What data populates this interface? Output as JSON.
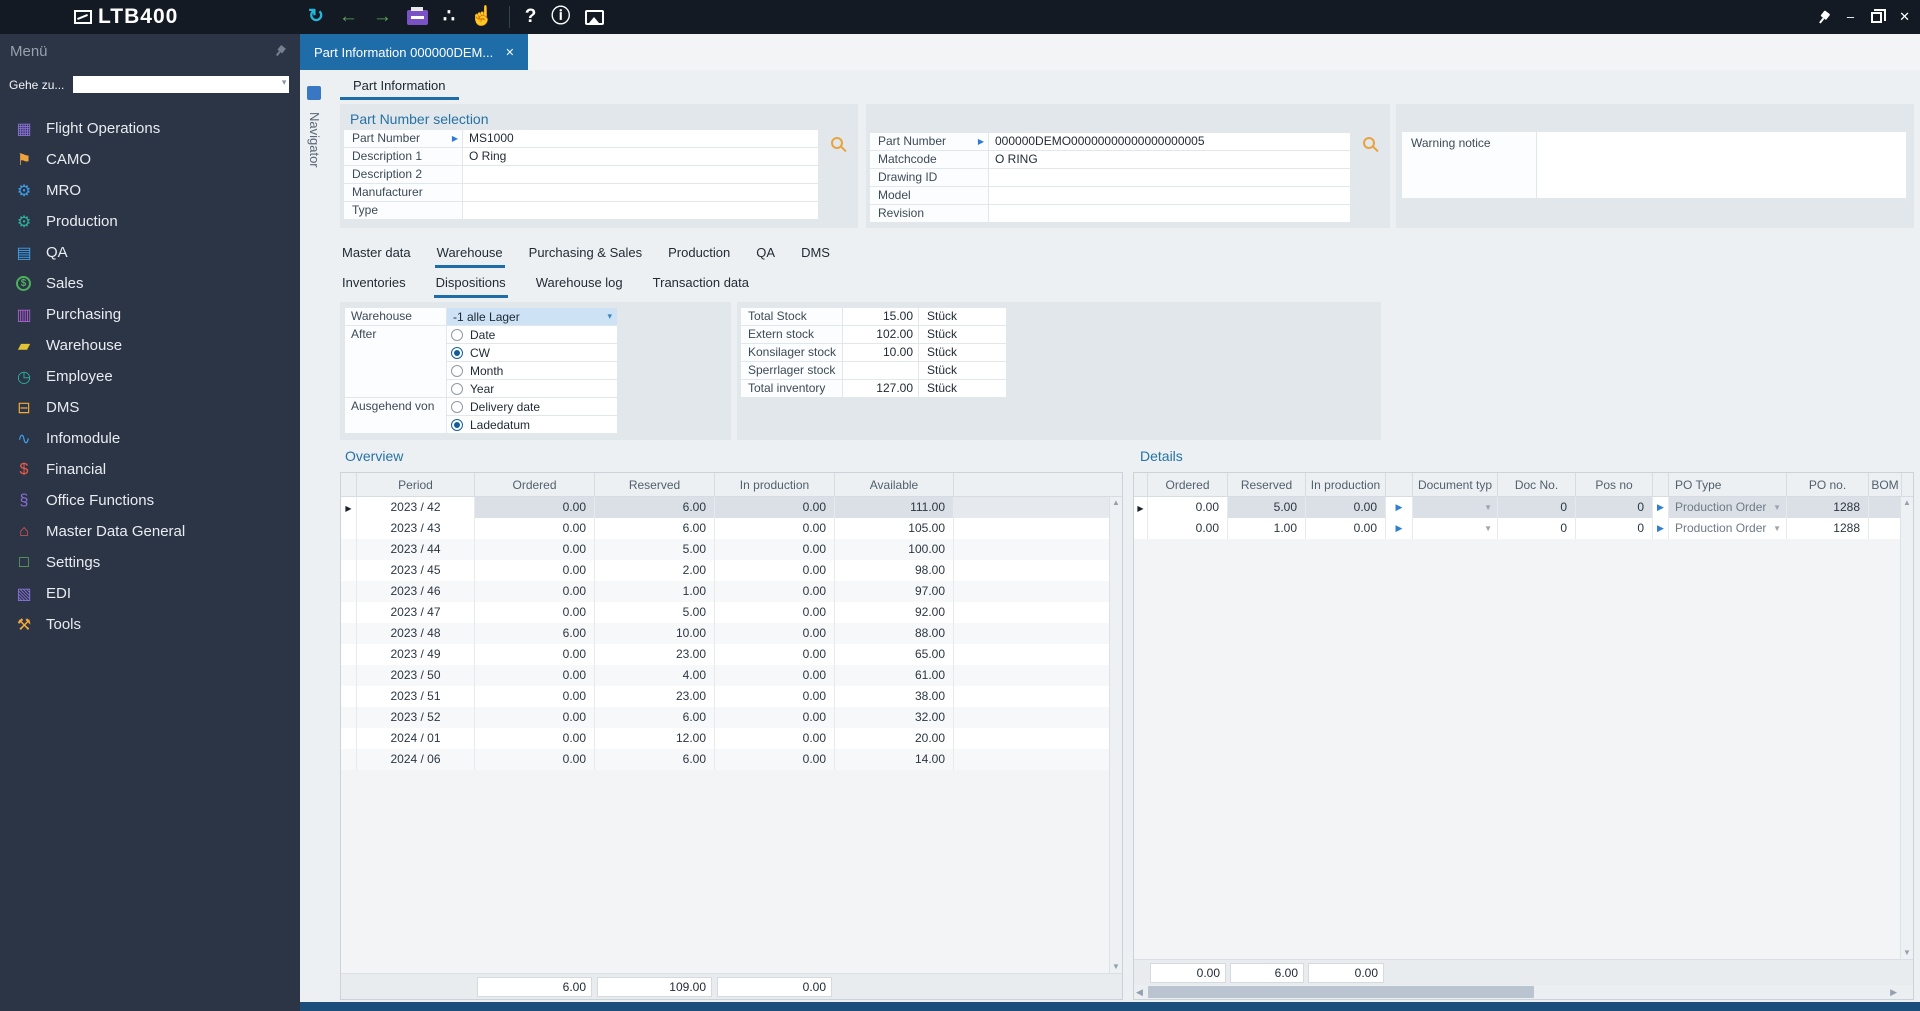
{
  "window": {
    "logo": "LTB400",
    "minimize_glyph": "–",
    "close_glyph": "✕"
  },
  "toolbar": {
    "icons": [
      {
        "name": "refresh-icon",
        "glyph": "↻",
        "color": "#24b6d8"
      },
      {
        "name": "back-icon",
        "glyph": "←",
        "color": "#59a957"
      },
      {
        "name": "forward-icon",
        "glyph": "→",
        "color": "#59a957"
      },
      {
        "name": "print-icon",
        "glyph": "",
        "color": "#7a52c4",
        "type": "printer"
      },
      {
        "name": "sitemap-icon",
        "glyph": "∴",
        "color": "#ffffff"
      },
      {
        "name": "touch-pointer-icon",
        "glyph": "☝",
        "color": "#f0a73a"
      },
      {
        "name": "toolbar-separator",
        "glyph": "",
        "type": "sep"
      },
      {
        "name": "help-icon",
        "glyph": "?",
        "color": "#ffffff"
      },
      {
        "name": "info-icon",
        "glyph": "ⓘ",
        "color": "#ffffff"
      },
      {
        "name": "image-icon",
        "glyph": "",
        "color": "#ffffff",
        "type": "image"
      }
    ]
  },
  "tab": {
    "title": "Part Information 000000DEM...",
    "close": "✕"
  },
  "navigator": {
    "label": "Navigator"
  },
  "page": {
    "tab_label": "Part Information"
  },
  "sidebar": {
    "header": "Menü",
    "goto_label": "Gehe zu...",
    "items": [
      {
        "label": "Flight Operations",
        "glyph": "▦",
        "color": "#8a70d8",
        "icon": "calendar-icon"
      },
      {
        "label": "CAMO",
        "glyph": "⚑",
        "color": "#efa23d",
        "icon": "ribbon-icon"
      },
      {
        "label": "MRO",
        "glyph": "⚙",
        "color": "#3f9fea",
        "icon": "gear-icon"
      },
      {
        "label": "Production",
        "glyph": "⚙",
        "color": "#2eb3a0",
        "icon": "gears-icon"
      },
      {
        "label": "QA",
        "glyph": "▤",
        "color": "#3f9fea",
        "icon": "briefcase-icon"
      },
      {
        "label": "Sales",
        "glyph": "$",
        "color": "#4cb05e",
        "icon": "dollar-circle-icon",
        "shape": "circle"
      },
      {
        "label": "Purchasing",
        "glyph": "▥",
        "color": "#b05fd6",
        "icon": "cart-icon"
      },
      {
        "label": "Warehouse",
        "glyph": "▰",
        "color": "#e3c235",
        "icon": "forklift-icon"
      },
      {
        "label": "Employee",
        "glyph": "◷",
        "color": "#2eb3a0",
        "icon": "clock-icon"
      },
      {
        "label": "DMS",
        "glyph": "⊟",
        "color": "#f3a83b",
        "icon": "folder-icon"
      },
      {
        "label": "Infomodule",
        "glyph": "∿",
        "color": "#3f9fea",
        "icon": "line-chart-icon"
      },
      {
        "label": "Financial",
        "glyph": "$",
        "color": "#f05a45",
        "icon": "money-icon"
      },
      {
        "label": "Office Functions",
        "glyph": "§",
        "color": "#8a70d8",
        "icon": "paperclip-icon"
      },
      {
        "label": "Master Data General",
        "glyph": "⌂",
        "color": "#ef5b55",
        "icon": "home-icon"
      },
      {
        "label": "Settings",
        "glyph": "□",
        "color": "#6abf69",
        "icon": "monitor-icon"
      },
      {
        "label": "EDI",
        "glyph": "▧",
        "color": "#8a70d8",
        "icon": "bar-chart-icon"
      },
      {
        "label": "Tools",
        "glyph": "⚒",
        "color": "#f3a83b",
        "icon": "tools-icon"
      }
    ]
  },
  "part_selection": {
    "title": "Part Number selection",
    "left_rows": [
      {
        "label": "Part Number",
        "value": "MS1000",
        "arrow": true,
        "search": true
      },
      {
        "label": "Description 1",
        "value": "O Ring"
      },
      {
        "label": "Description 2",
        "value": ""
      },
      {
        "label": "Manufacturer",
        "value": ""
      },
      {
        "label": "Type",
        "value": ""
      }
    ],
    "right_rows": [
      {
        "label": "Part Number",
        "value": "000000DEMO00000000000000000005",
        "arrow": true,
        "search": true
      },
      {
        "label": "Matchcode",
        "value": "O RING"
      },
      {
        "label": "Drawing ID",
        "value": ""
      },
      {
        "label": "Model",
        "value": ""
      },
      {
        "label": "Revision",
        "value": ""
      }
    ],
    "warning": {
      "label": "Warning notice",
      "value": ""
    }
  },
  "tabs": {
    "main": [
      "Master data",
      "Warehouse",
      "Purchasing & Sales",
      "Production",
      "QA",
      "DMS"
    ],
    "main_active": 1,
    "sub": [
      "Inventories",
      "Dispositions",
      "Warehouse log",
      "Transaction data"
    ],
    "sub_active": 1
  },
  "filter": {
    "warehouse_label": "Warehouse",
    "warehouse_value": "-1  alle Lager",
    "after_label": "After",
    "after_options": [
      {
        "label": "Date",
        "selected": false
      },
      {
        "label": "CW",
        "selected": true
      },
      {
        "label": "Month",
        "selected": false
      },
      {
        "label": "Year",
        "selected": false
      }
    ],
    "from_label": "Ausgehend von",
    "from_options": [
      {
        "label": "Delivery date",
        "selected": false
      },
      {
        "label": "Ladedatum",
        "selected": true
      }
    ]
  },
  "stock": {
    "rows": [
      {
        "label": "Total Stock",
        "value": "15.00",
        "unit": "Stück"
      },
      {
        "label": "Extern stock",
        "value": "102.00",
        "unit": "Stück"
      },
      {
        "label": "Konsilager stock",
        "value": "10.00",
        "unit": "Stück"
      },
      {
        "label": "Sperrlager stock",
        "value": "",
        "unit": "Stück"
      },
      {
        "label": "Total inventory",
        "value": "127.00",
        "unit": "Stück"
      }
    ]
  },
  "overview": {
    "title": "Overview",
    "headers": [
      "Period",
      "Ordered",
      "Reserved",
      "In production",
      "Available"
    ],
    "selected_row": 0,
    "rows": [
      [
        "2023 / 42",
        "0.00",
        "6.00",
        "0.00",
        "111.00"
      ],
      [
        "2023 / 43",
        "0.00",
        "6.00",
        "0.00",
        "105.00"
      ],
      [
        "2023 / 44",
        "0.00",
        "5.00",
        "0.00",
        "100.00"
      ],
      [
        "2023 / 45",
        "0.00",
        "2.00",
        "0.00",
        "98.00"
      ],
      [
        "2023 / 46",
        "0.00",
        "1.00",
        "0.00",
        "97.00"
      ],
      [
        "2023 / 47",
        "0.00",
        "5.00",
        "0.00",
        "92.00"
      ],
      [
        "2023 / 48",
        "6.00",
        "10.00",
        "0.00",
        "88.00"
      ],
      [
        "2023 / 49",
        "0.00",
        "23.00",
        "0.00",
        "65.00"
      ],
      [
        "2023 / 50",
        "0.00",
        "4.00",
        "0.00",
        "61.00"
      ],
      [
        "2023 / 51",
        "0.00",
        "23.00",
        "0.00",
        "38.00"
      ],
      [
        "2023 / 52",
        "0.00",
        "6.00",
        "0.00",
        "32.00"
      ],
      [
        "2024 / 01",
        "0.00",
        "12.00",
        "0.00",
        "20.00"
      ],
      [
        "2024 / 06",
        "0.00",
        "6.00",
        "0.00",
        "14.00"
      ]
    ],
    "footer": [
      "6.00",
      "109.00",
      "0.00"
    ]
  },
  "details": {
    "title": "Details",
    "headers": [
      "Ordered",
      "Reserved",
      "In production",
      "Document typ",
      "Doc No.",
      "Pos no",
      "PO Type",
      "PO no.",
      "BOM"
    ],
    "selected_row": 0,
    "rows": [
      [
        "0.00",
        "5.00",
        "0.00",
        "",
        "0",
        "0",
        "Production Order",
        "1288",
        ""
      ],
      [
        "0.00",
        "1.00",
        "0.00",
        "",
        "0",
        "0",
        "Production Order",
        "1288",
        ""
      ]
    ],
    "footer": [
      "0.00",
      "6.00",
      "0.00"
    ]
  }
}
